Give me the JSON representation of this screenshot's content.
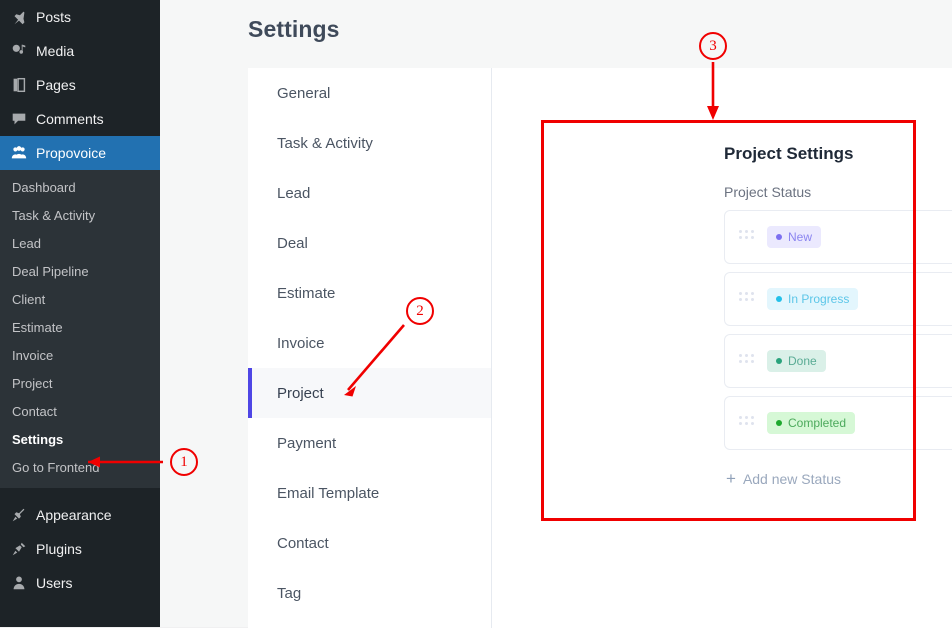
{
  "admin_menu": {
    "top_items": [
      {
        "label": "Posts",
        "icon": "pin-icon",
        "current": false
      },
      {
        "label": "Media",
        "icon": "media-icon",
        "current": false
      },
      {
        "label": "Pages",
        "icon": "pages-icon",
        "current": false
      },
      {
        "label": "Comments",
        "icon": "comments-icon",
        "current": false
      },
      {
        "label": "Propovoice",
        "icon": "propovoice-icon",
        "current": true
      }
    ],
    "submenu": [
      {
        "label": "Dashboard",
        "current": false
      },
      {
        "label": "Task & Activity",
        "current": false
      },
      {
        "label": "Lead",
        "current": false
      },
      {
        "label": "Deal Pipeline",
        "current": false
      },
      {
        "label": "Client",
        "current": false
      },
      {
        "label": "Estimate",
        "current": false
      },
      {
        "label": "Invoice",
        "current": false
      },
      {
        "label": "Project",
        "current": false
      },
      {
        "label": "Contact",
        "current": false
      },
      {
        "label": "Settings",
        "current": true
      },
      {
        "label": "Go to Frontend",
        "current": false
      }
    ],
    "bottom_items": [
      {
        "label": "Appearance",
        "icon": "appearance-icon"
      },
      {
        "label": "Plugins",
        "icon": "plugins-icon"
      },
      {
        "label": "Users",
        "icon": "users-icon"
      }
    ],
    "colors": {
      "background": "#1d2327",
      "submenu_background": "#2c3338",
      "current_highlight": "#2271b1"
    }
  },
  "page": {
    "title": "Settings"
  },
  "settings_nav": {
    "items": [
      {
        "label": "General",
        "active": false
      },
      {
        "label": "Task & Activity",
        "active": false
      },
      {
        "label": "Lead",
        "active": false
      },
      {
        "label": "Deal",
        "active": false
      },
      {
        "label": "Estimate",
        "active": false
      },
      {
        "label": "Invoice",
        "active": false
      },
      {
        "label": "Project",
        "active": true
      },
      {
        "label": "Payment",
        "active": false
      },
      {
        "label": "Email Template",
        "active": false
      },
      {
        "label": "Contact",
        "active": false
      },
      {
        "label": "Tag",
        "active": false
      }
    ],
    "active_accent": "#4f46e5"
  },
  "project_settings": {
    "title": "Project Settings",
    "subtitle": "Project Status",
    "statuses": [
      {
        "label": "New",
        "bg": "#ebe9fe",
        "fg": "#8b85f0",
        "dot": "#7c6ff0",
        "has_edit": true,
        "has_delete": true
      },
      {
        "label": "In Progress",
        "bg": "#e3f6fd",
        "fg": "#5cc6e8",
        "dot": "#23c0e9",
        "has_edit": true,
        "has_delete": true
      },
      {
        "label": "Done",
        "bg": "#daf0e8",
        "fg": "#59ab94",
        "dot": "#2aa37c",
        "has_edit": true,
        "has_delete": true
      },
      {
        "label": "Completed",
        "bg": "#d6f8d6",
        "fg": "#4caa5c",
        "dot": "#1ea92e",
        "has_edit": true,
        "has_delete": false
      }
    ],
    "add_label": "Add new Status",
    "add_icon": "plus-icon"
  },
  "annotations": {
    "color": "#f00000",
    "markers": [
      {
        "number": "1",
        "target": "Settings sidebar menu item"
      },
      {
        "number": "2",
        "target": "Project settings tab"
      },
      {
        "number": "3",
        "target": "Project Settings panel"
      }
    ]
  }
}
